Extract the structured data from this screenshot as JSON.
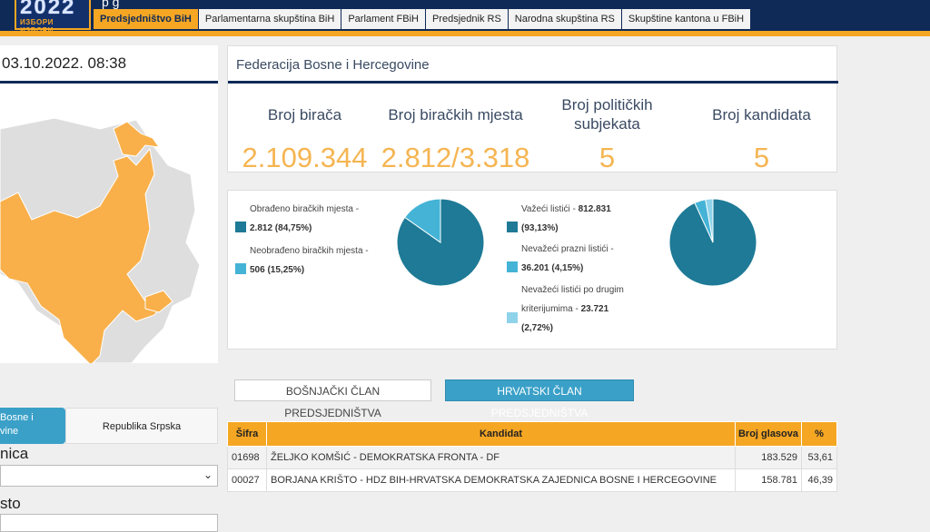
{
  "header": {
    "logo_year": "2022",
    "logo_subtitle": "ИЗБОРИ ИЗБОРИ",
    "title_fragment": "p g",
    "nav": [
      {
        "label": "Predsjedništvo BiH",
        "active": true
      },
      {
        "label": "Parlamentarna skupština BiH",
        "active": false
      },
      {
        "label": "Parlament FBiH",
        "active": false
      },
      {
        "label": "Predsjednik RS",
        "active": false
      },
      {
        "label": "Narodna skupština RS",
        "active": false
      },
      {
        "label": "Skupštine kantona u FBiH",
        "active": false
      }
    ]
  },
  "sidebar": {
    "datetime": "03.10.2022. 08:38",
    "map_colors": {
      "highlight": "#f9b04a",
      "other": "#dedede"
    },
    "entity_tabs": [
      "Bosne i\nvine",
      "Republika Srpska"
    ],
    "label_1": "nica",
    "label_2": "sto"
  },
  "stats": {
    "title": "Federacija Bosne i Hercegovine",
    "items": [
      {
        "label": "Broj birača",
        "value": "2.109.344"
      },
      {
        "label": "Broj biračkih mjesta",
        "value": "2.812/3.318"
      },
      {
        "label": "Broj političkih subjekata",
        "value": "5"
      },
      {
        "label": "Broj kandidata",
        "value": "5"
      }
    ]
  },
  "pie1": {
    "legend": [
      {
        "label": "Obrađeno biračkih mjesta -",
        "value": "2.812 (84,75%)",
        "color": "#1e7a96"
      },
      {
        "label": "Neobrađeno biračkih mjesta -",
        "value": "506 (15,25%)",
        "color": "#44b3d6"
      }
    ],
    "fractions": [
      84.75,
      15.25
    ]
  },
  "pie2": {
    "legend": [
      {
        "label": "Važeći listići -",
        "value": "812.831",
        "pct": "(93,13%)",
        "color": "#1e7a96"
      },
      {
        "label": "Nevažeći prazni listići -",
        "value": "36.201",
        "pct": "(4,15%)",
        "color": "#44b3d6"
      },
      {
        "label": "Nevažeći listići po drugim kriterijumima -",
        "value": "23.721",
        "pct": "(2,72%)",
        "color": "#8fd3ea"
      }
    ],
    "fractions": [
      93.13,
      4.15,
      2.72
    ]
  },
  "buttons": {
    "bosniak": "BOŠNJAČKI ČLAN PREDSJEDNIŠTVA",
    "croat": "HRVATSKI ČLAN PREDSJEDNIŠTVA"
  },
  "results": {
    "headers": [
      "Šifra",
      "Kandidat",
      "Broj glasova",
      "%"
    ],
    "rows": [
      [
        "01698",
        "ŽELJKO KOMŠIĆ - DEMOKRATSKA FRONTA - DF",
        "183.529",
        "53,61"
      ],
      [
        "00027",
        "BORJANA KRIŠTO - HDZ BIH-HRVATSKA DEMOKRATSKA ZAJEDNICA BOSNE I HERCEGOVINE",
        "158.781",
        "46,39"
      ]
    ]
  }
}
